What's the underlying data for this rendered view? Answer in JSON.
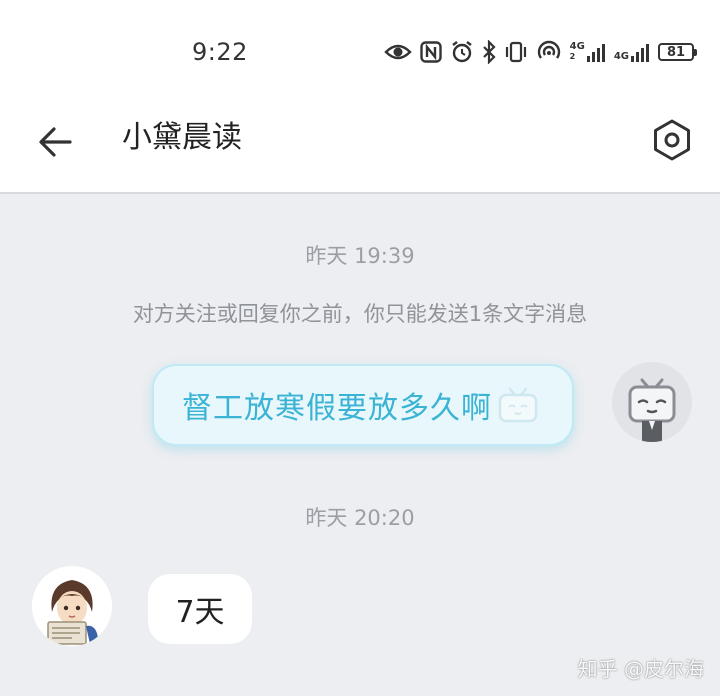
{
  "status_bar": {
    "time": "9:22",
    "icons": [
      "eye-icon",
      "nfc-icon",
      "alarm-icon",
      "bluetooth-icon",
      "vibrate-icon",
      "hotspot-icon",
      "signal-4g-icon",
      "signal-4g-icon",
      "battery-icon"
    ],
    "net_1": "4G",
    "net_1_sup": "2",
    "net_2": "4G",
    "battery": "81"
  },
  "header": {
    "title": "小黛晨读"
  },
  "messages": [
    {
      "type": "timestamp",
      "text": "昨天 19:39"
    },
    {
      "type": "notice",
      "text": "对方关注或回复你之前，你只能发送1条文字消息"
    },
    {
      "type": "outgoing",
      "text": "督工放寒假要放多久啊",
      "emoji": "bilibili-tv-emoji"
    },
    {
      "type": "timestamp",
      "text": "昨天 20:20"
    },
    {
      "type": "incoming",
      "text": "7天"
    }
  ],
  "watermark": "知乎 @皮尔海",
  "colors": {
    "outgoing_text": "#3ab3d4",
    "outgoing_bubble": "#e8f7fb",
    "background": "#eceef1"
  }
}
